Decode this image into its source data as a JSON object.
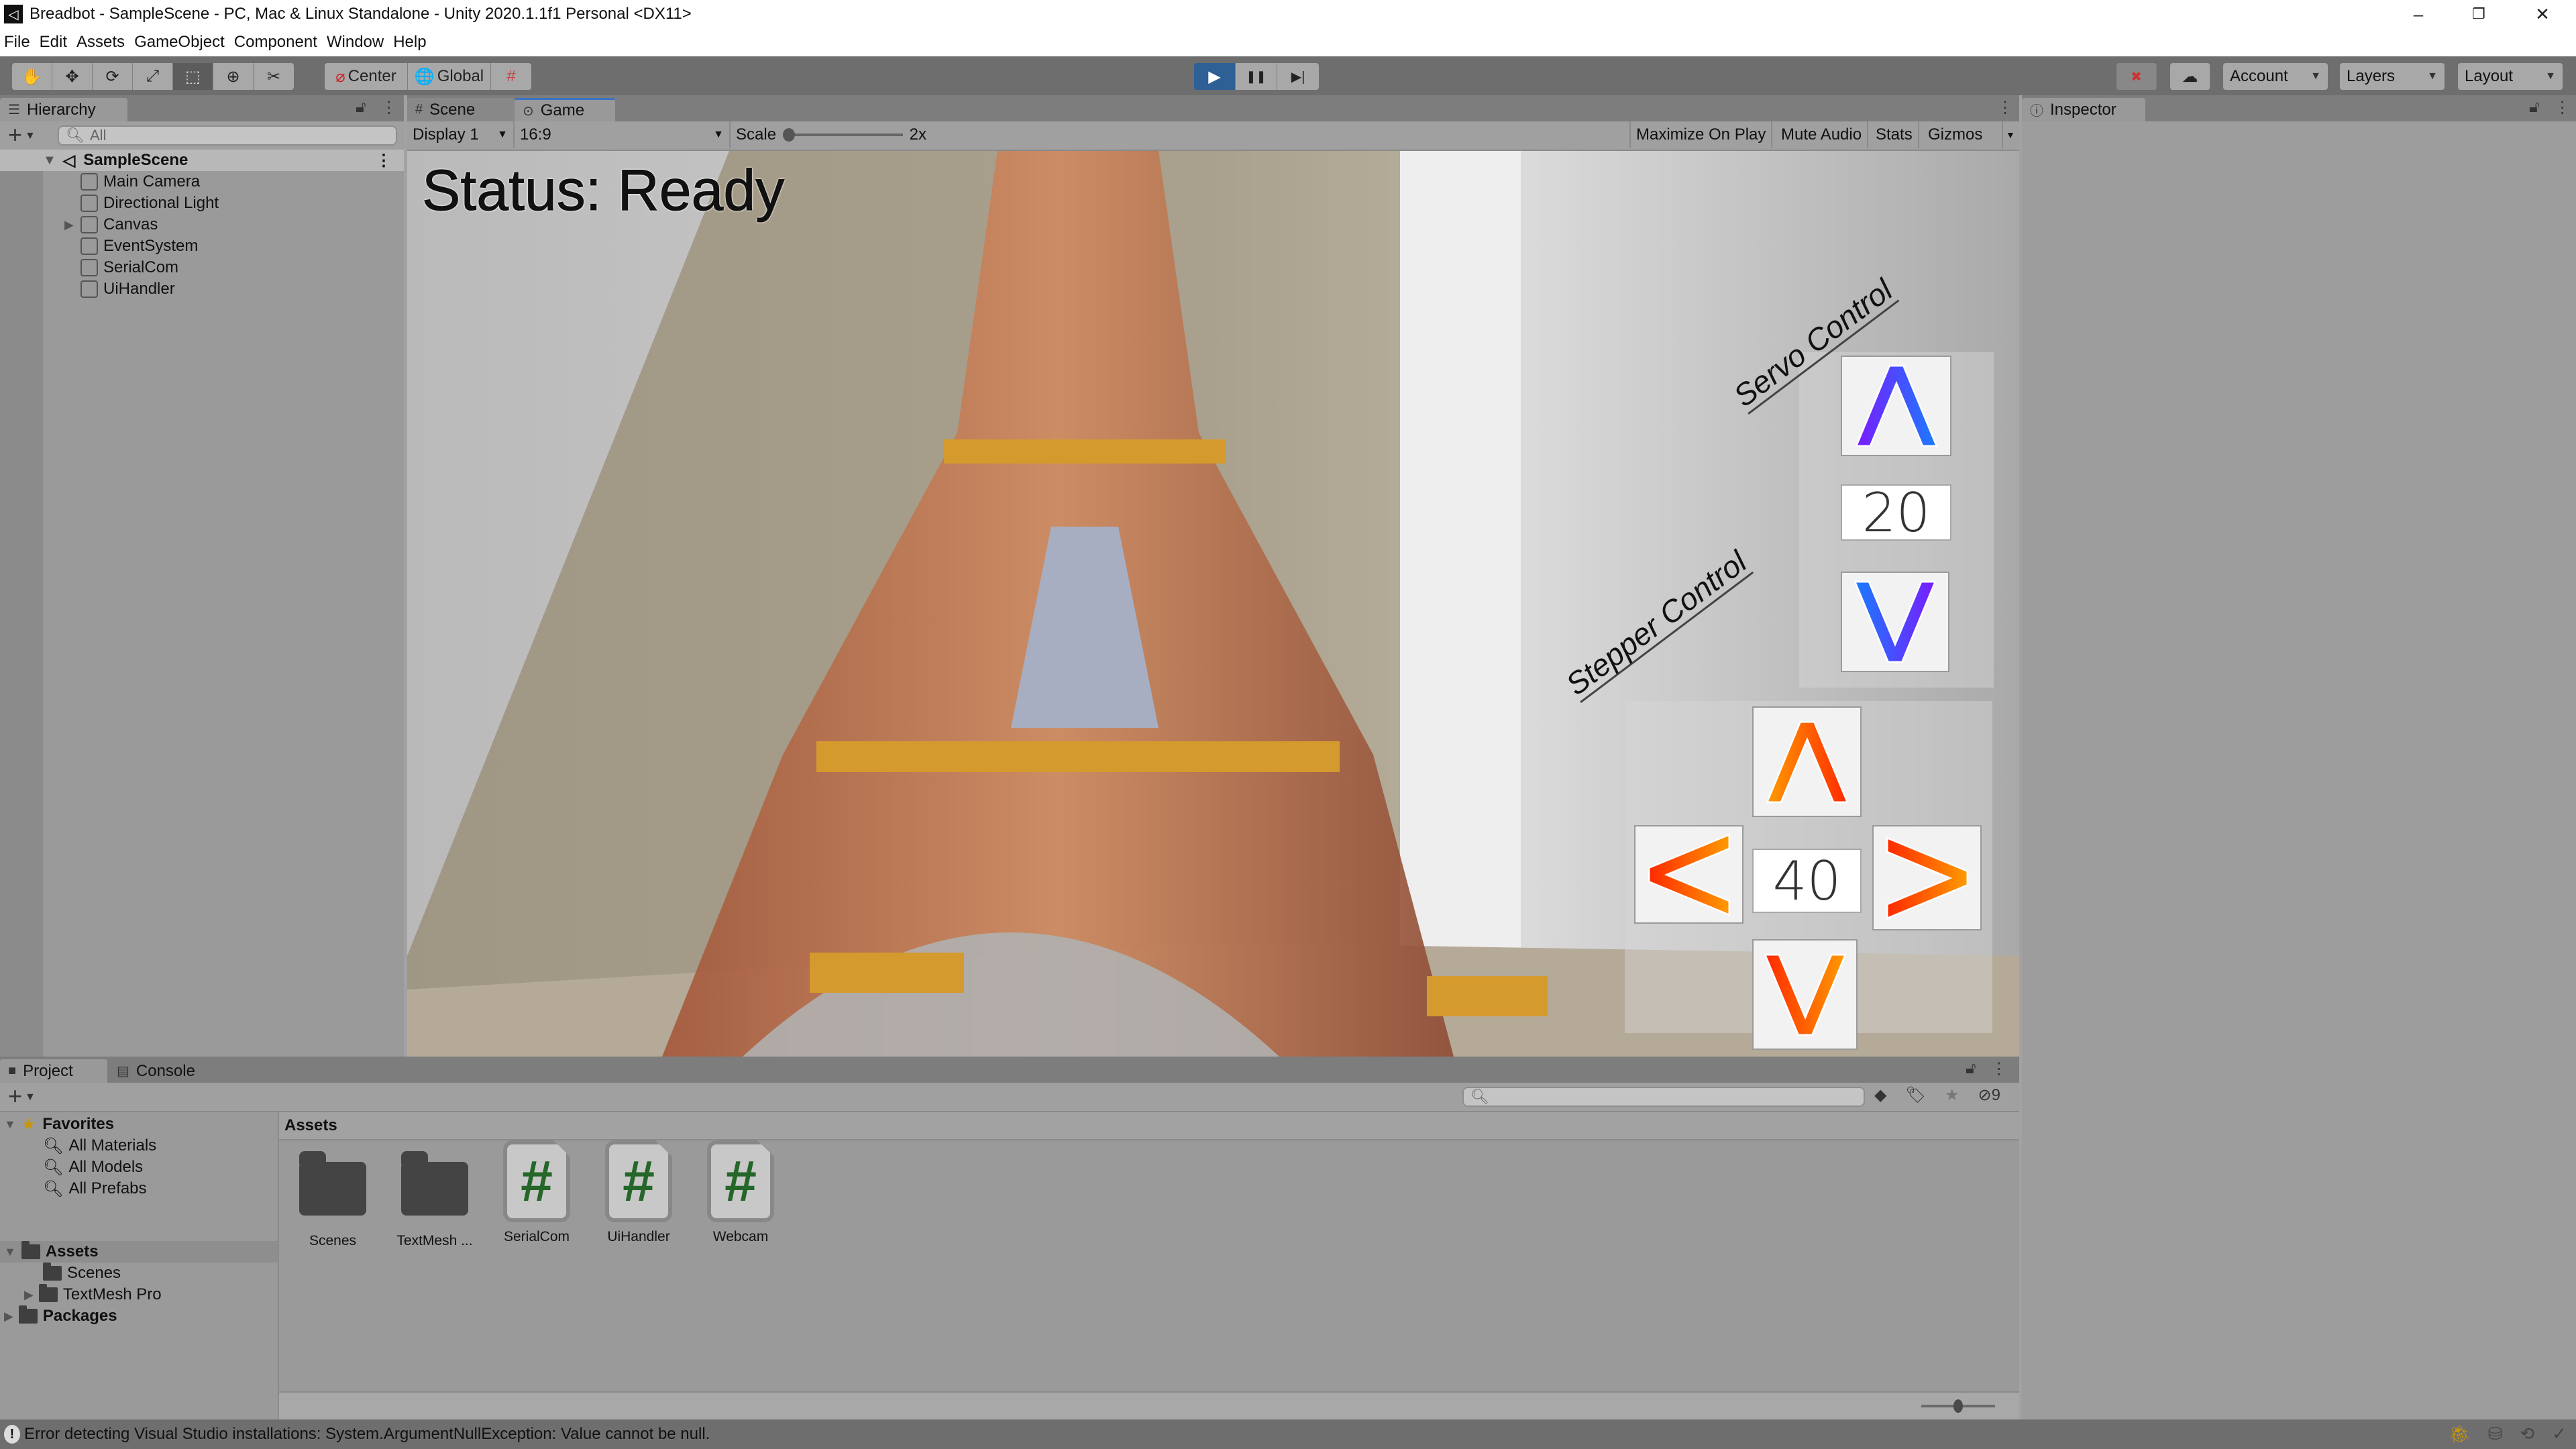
{
  "window": {
    "title": "Breadbot - SampleScene - PC, Mac & Linux Standalone - Unity 2020.1.1f1 Personal <DX11>",
    "controls": {
      "minimize": "–",
      "maximize": "❐",
      "close": "✕"
    }
  },
  "menu": [
    "File",
    "Edit",
    "Assets",
    "GameObject",
    "Component",
    "Window",
    "Help"
  ],
  "toolbar": {
    "tools": [
      {
        "name": "hand-tool",
        "icon": "✋"
      },
      {
        "name": "move-tool",
        "icon": "✥"
      },
      {
        "name": "rotate-tool",
        "icon": "⟳"
      },
      {
        "name": "scale-tool",
        "icon": "⤢"
      },
      {
        "name": "rect-tool",
        "icon": "⬚"
      },
      {
        "name": "transform-tool",
        "icon": "⊕"
      },
      {
        "name": "custom-tool",
        "icon": "✂"
      }
    ],
    "pivot_mode": "Center",
    "pivot_rotation": "Global",
    "snap_icon": "#",
    "play_icon": "▶",
    "pause_icon": "❚❚",
    "step_icon": "▶|",
    "collab_icon": "☁",
    "account": "Account",
    "layers": "Layers",
    "layout": "Layout"
  },
  "hierarchy": {
    "tab": "Hierarchy",
    "search_placeholder": "All",
    "scene": "SampleScene",
    "items": [
      {
        "label": "Main Camera",
        "expandable": false
      },
      {
        "label": "Directional Light",
        "expandable": false
      },
      {
        "label": "Canvas",
        "expandable": true
      },
      {
        "label": "EventSystem",
        "expandable": false
      },
      {
        "label": "SerialCom",
        "expandable": false
      },
      {
        "label": "UiHandler",
        "expandable": false
      }
    ]
  },
  "gameview": {
    "tabs": [
      {
        "label": "Scene",
        "icon": "#"
      },
      {
        "label": "Game",
        "icon": "🎮"
      }
    ],
    "active_tab": "Game",
    "display": "Display 1",
    "aspect": "16:9",
    "scale_label": "Scale",
    "scale_value": "2x",
    "scale_slider_fraction": 0.0,
    "buttons": [
      "Maximize On Play",
      "Mute Audio",
      "Stats",
      "Gizmos"
    ],
    "game_ui": {
      "status_text": "Status: Ready",
      "servo": {
        "title": "Servo Control",
        "value": "20",
        "up_icon": "Λ",
        "down_icon": "V",
        "gradient": [
          "#7a1cff",
          "#1a7bff"
        ]
      },
      "stepper": {
        "title": "Stepper Control",
        "value": "40",
        "up_icon": "Λ",
        "down_icon": "V",
        "left_icon": "<",
        "right_icon": ">",
        "gradient": [
          "#ff9a00",
          "#ff2a00"
        ]
      }
    }
  },
  "inspector": {
    "tab": "Inspector"
  },
  "project": {
    "tabs": [
      "Project",
      "Console"
    ],
    "favorites": {
      "label": "Favorites",
      "items": [
        "All Materials",
        "All Models",
        "All Prefabs"
      ]
    },
    "assets_tree": {
      "label": "Assets",
      "children": [
        {
          "label": "Scenes",
          "expandable": false
        },
        {
          "label": "TextMesh Pro",
          "expandable": true
        }
      ]
    },
    "packages": "Packages",
    "breadcrumb": "Assets",
    "hidden_count": "9",
    "grid": [
      {
        "label": "Scenes",
        "type": "folder"
      },
      {
        "label": "TextMesh ...",
        "type": "folder"
      },
      {
        "label": "SerialCom",
        "type": "script"
      },
      {
        "label": "UiHandler",
        "type": "script"
      },
      {
        "label": "Webcam",
        "type": "script"
      }
    ],
    "icon_size_fraction": 0.5
  },
  "statusbar": {
    "message": "Error detecting Visual Studio installations: System.ArgumentNullException: Value cannot be null."
  },
  "colors": {
    "play_active": "#2e5f95",
    "script_hash": "#256629",
    "favorite_star": "#c8960c",
    "bug_icon": "#c8960c"
  }
}
